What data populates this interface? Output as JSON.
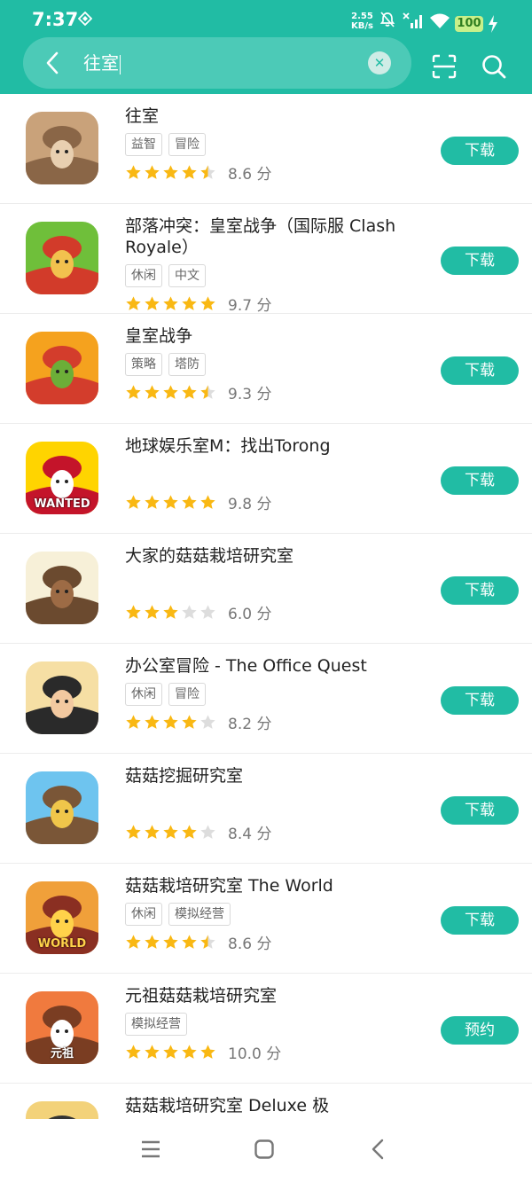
{
  "status_bar": {
    "time": "7:37",
    "net_speed_value": "2.55",
    "net_speed_unit": "KB/s",
    "battery": "100"
  },
  "search": {
    "query": "往室"
  },
  "results": [
    {
      "name": "往室",
      "tags": [
        "益智",
        "冒险"
      ],
      "rating": 4.5,
      "score": "8.6 分",
      "button": "下载",
      "icon": {
        "bg1": "#c9a27a",
        "bg2": "#8a6647",
        "fg": "#e8cfb0"
      }
    },
    {
      "name": "部落冲突：皇室战争（国际服 Clash Royale）",
      "tags": [
        "休闲",
        "中文"
      ],
      "rating": 5,
      "score": "9.7 分",
      "button": "下载",
      "icon": {
        "bg1": "#6fbf3a",
        "bg2": "#d23b2a",
        "fg": "#f2c14e"
      }
    },
    {
      "name": "皇室战争",
      "tags": [
        "策略",
        "塔防"
      ],
      "rating": 4.5,
      "score": "9.3 分",
      "button": "下载",
      "icon": {
        "bg1": "#f5a21e",
        "bg2": "#d33d2c",
        "fg": "#6cae38"
      }
    },
    {
      "name": "地球娱乐室M：找出Torong",
      "tags": [],
      "rating": 5,
      "score": "9.8 分",
      "button": "下载",
      "icon": {
        "bg1": "#ffd400",
        "bg2": "#c4142a",
        "fg": "#ffffff"
      },
      "icon_text": "WANTED"
    },
    {
      "name": "大家的菇菇栽培研究室",
      "tags": [],
      "rating": 3,
      "score": "6.0 分",
      "button": "下载",
      "icon": {
        "bg1": "#f7f0d8",
        "bg2": "#6b4a2f",
        "fg": "#9d6b45"
      }
    },
    {
      "name": "办公室冒险 - The Office Quest",
      "tags": [
        "休闲",
        "冒险"
      ],
      "rating": 4,
      "score": "8.2 分",
      "button": "下载",
      "icon": {
        "bg1": "#f6dfa4",
        "bg2": "#2a2a2a",
        "fg": "#f3c9a0"
      }
    },
    {
      "name": "菇菇挖掘研究室",
      "tags": [],
      "rating": 4,
      "score": "8.4 分",
      "button": "下载",
      "icon": {
        "bg1": "#6ec4ef",
        "bg2": "#7a5637",
        "fg": "#f0c64a"
      }
    },
    {
      "name": "菇菇栽培研究室 The World",
      "tags": [
        "休闲",
        "模拟经营"
      ],
      "rating": 4.5,
      "score": "8.6 分",
      "button": "下载",
      "icon": {
        "bg1": "#f0a03a",
        "bg2": "#8a2f22",
        "fg": "#ffd24a"
      },
      "icon_text": "WORLD"
    },
    {
      "name": "元祖菇菇栽培研究室",
      "tags": [
        "模拟经营"
      ],
      "rating": 5,
      "score": "10.0 分",
      "button": "预约",
      "icon": {
        "bg1": "#f07a3e",
        "bg2": "#7a3d22",
        "fg": "#ffffff"
      },
      "icon_text": "元祖"
    },
    {
      "name": "菇菇栽培研究室 Deluxe 极",
      "tags": [],
      "rating": 0,
      "score": "",
      "button": "",
      "icon": {
        "bg1": "#f3d27a",
        "bg2": "#333333",
        "fg": "#ffffff"
      }
    }
  ],
  "colors": {
    "accent": "#21bca4",
    "star_on": "#f9b813",
    "star_off": "#dddddd"
  }
}
